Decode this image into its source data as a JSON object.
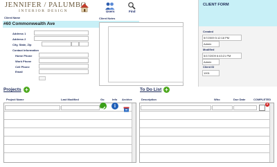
{
  "brand": {
    "name": "Jennifer Palumbo",
    "name_display": "JENNIFER / PALUMBO",
    "sub": "INTERIOR DESIGN"
  },
  "nav": {
    "home_label": "",
    "users_label": "Users",
    "find_label": "Find"
  },
  "client_form": {
    "title": "CLIENT FORM",
    "created_label": "Created",
    "created_value": "5/7/2009 5:12:18 PM",
    "created_by": "Admin",
    "modified_label": "Modified",
    "modified_value": "5/17/2009 6:43:21 PM",
    "modified_by": "Admin",
    "client_id_label": "Client ID",
    "client_id_value": "1001"
  },
  "client": {
    "name_label": "Client Name",
    "name_value": "#60 Commonwealth Ave",
    "address1_label": "Address 1",
    "address2_label": "Address 2",
    "city_label": "City, State, Zip",
    "contact_label": "Contact Information",
    "home_label": "Home Phone",
    "work_label": "Work Phone",
    "cell_label": "Cell Phone",
    "email_label": "Email",
    "notes_label": "Client Notes"
  },
  "projects": {
    "title": "Projects",
    "columns": [
      "Project Name",
      "Last Modified",
      "Go",
      "Info",
      "Archive"
    ]
  },
  "todo": {
    "title": "To Do List",
    "columns": [
      "Description",
      "Who",
      "Due Date",
      "COMPLETED"
    ]
  },
  "colors": {
    "accent": "#c8f0f7",
    "add_green": "#4ea91f",
    "go_green": "#3aa017",
    "info_blue": "#1f5fb8",
    "delete_red": "#d11f1f"
  }
}
